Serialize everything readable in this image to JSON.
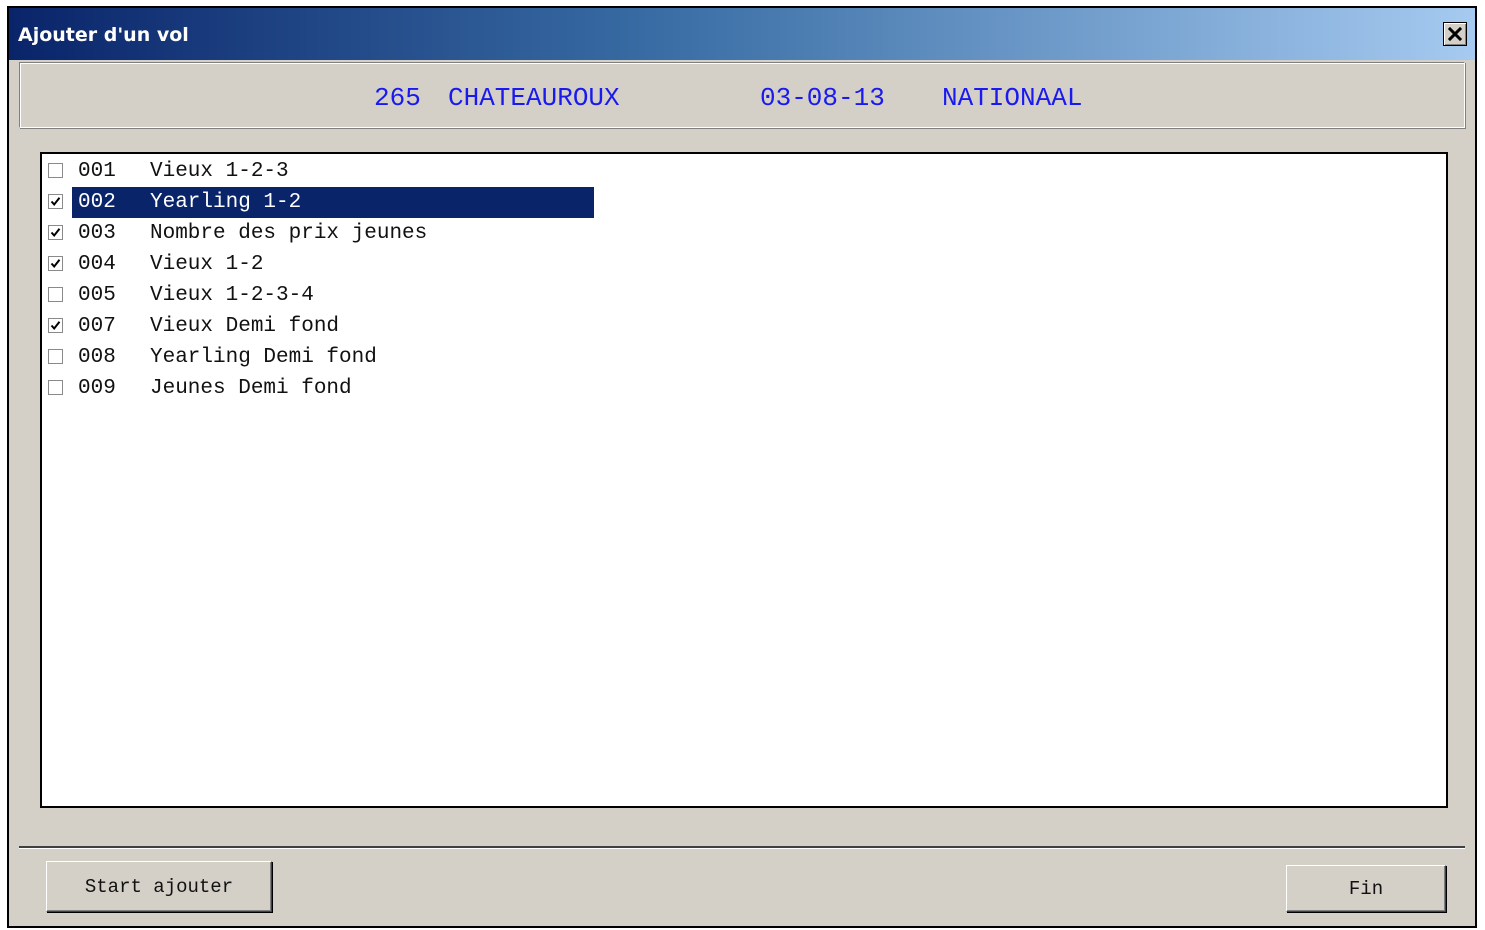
{
  "window": {
    "title": "Ajouter d'un vol"
  },
  "header": {
    "race_number": "265",
    "location": "CHATEAUROUX",
    "date": "03-08-13",
    "category": "NATIONAAL"
  },
  "list": {
    "items": [
      {
        "code": "001",
        "name": "Vieux 1-2-3",
        "checked": false,
        "selected": false
      },
      {
        "code": "002",
        "name": "Yearling 1-2",
        "checked": true,
        "selected": true
      },
      {
        "code": "003",
        "name": "Nombre des prix jeunes",
        "checked": true,
        "selected": false
      },
      {
        "code": "004",
        "name": "Vieux 1-2",
        "checked": true,
        "selected": false
      },
      {
        "code": "005",
        "name": "Vieux 1-2-3-4",
        "checked": false,
        "selected": false
      },
      {
        "code": "007",
        "name": "Vieux Demi fond",
        "checked": true,
        "selected": false
      },
      {
        "code": "008",
        "name": "Yearling Demi fond",
        "checked": false,
        "selected": false
      },
      {
        "code": "009",
        "name": "Jeunes Demi fond",
        "checked": false,
        "selected": false
      }
    ]
  },
  "buttons": {
    "start_label": "Start ajouter",
    "end_label": "Fin"
  },
  "colors": {
    "title_gradient_start": "#0a246a",
    "title_gradient_end": "#a6caf0",
    "header_text": "#1a1aee",
    "selection": "#0a246a",
    "dialog_bg": "#d4d0c8"
  }
}
